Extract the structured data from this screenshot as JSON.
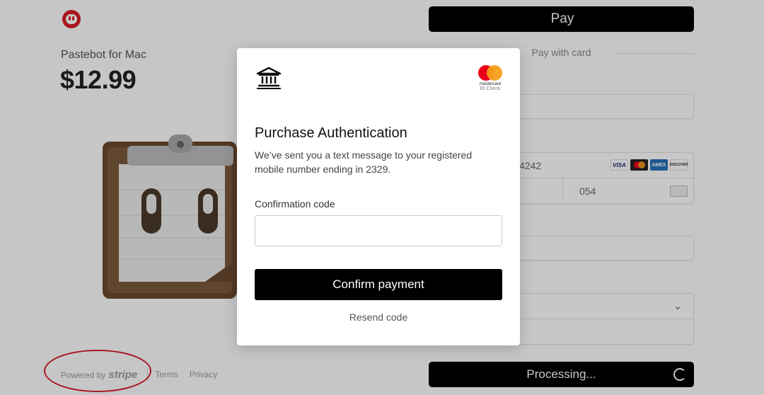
{
  "product": {
    "name": "Pastebot for Mac",
    "price": "$12.99"
  },
  "footer": {
    "powered_by": "Powered by",
    "brand": "stripe",
    "terms": "Terms",
    "privacy": "Privacy"
  },
  "payment": {
    "apple_pay_label": "Pay",
    "divider_label": "Pay with card",
    "card_number_partial": "4242",
    "cvc_partial": "054",
    "card_brands": [
      "VISA",
      "",
      "AMEX",
      "DISCOVER"
    ],
    "processing_label": "Processing..."
  },
  "modal": {
    "brand_logo_text": "mastercard",
    "brand_sub_text": "ID Check",
    "title": "Purchase Authentication",
    "message": "We’ve sent you a text message to your registered mobile number ending in 2329.",
    "code_label": "Confirmation code",
    "code_value": "",
    "confirm_label": "Confirm payment",
    "resend_label": "Resend code"
  },
  "colors": {
    "accent": "#000000",
    "logo_red": "#d91c27",
    "highlight_ellipse": "#d91c27"
  }
}
